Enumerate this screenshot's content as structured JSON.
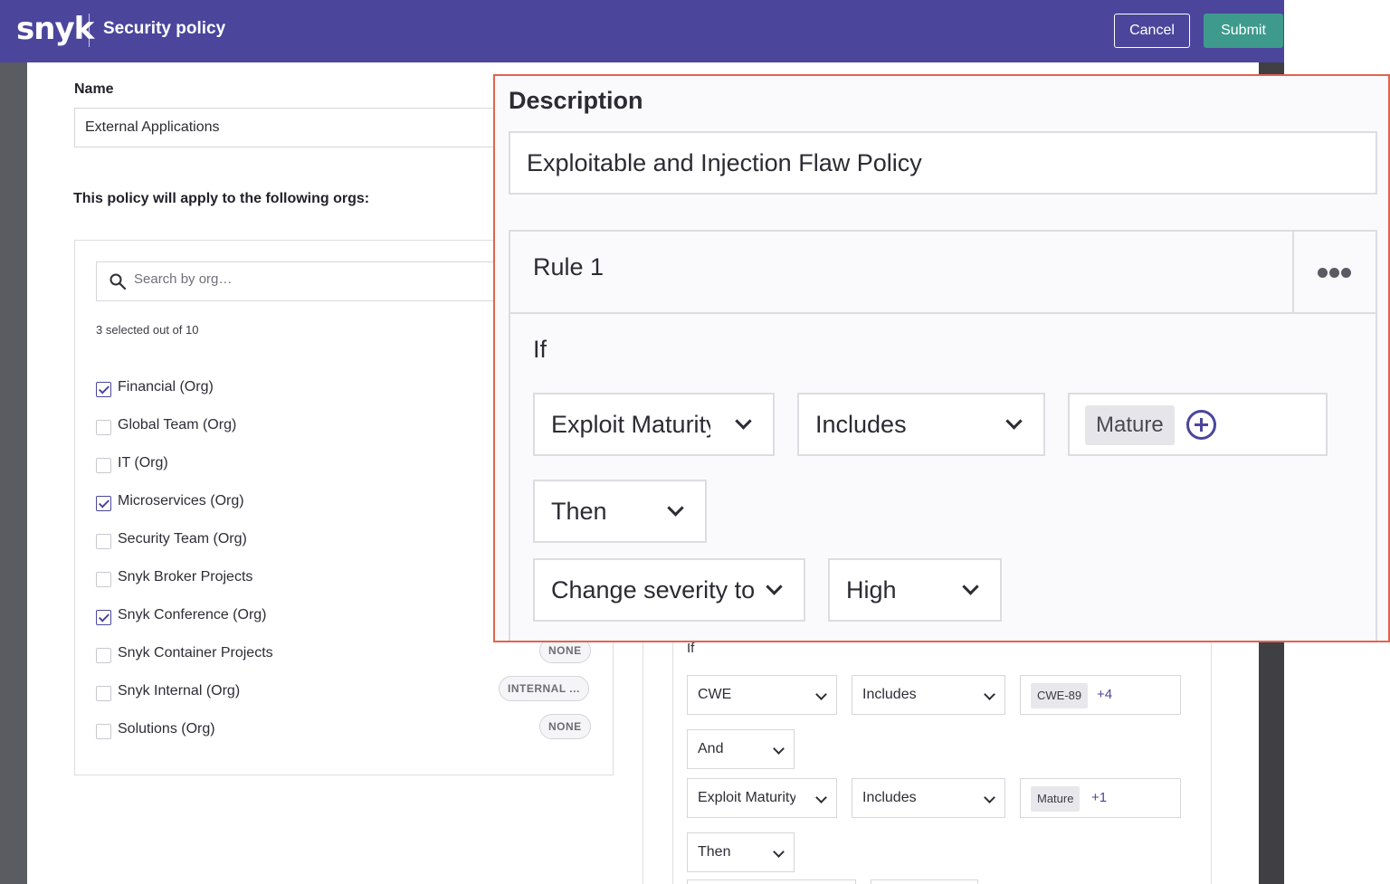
{
  "header": {
    "logo": "snyk",
    "title": "Security policy",
    "cancel_label": "Cancel",
    "submit_label": "Submit"
  },
  "form": {
    "name_label": "Name",
    "name_value": "External Applications",
    "orgs_label": "This policy will apply to the following orgs:",
    "search_placeholder": "Search by org…",
    "selected_count": "3 selected out of 10"
  },
  "orgs": [
    {
      "label": "Financial (Org)",
      "checked": true,
      "badge": ""
    },
    {
      "label": "Global Team (Org)",
      "checked": false,
      "badge": ""
    },
    {
      "label": "IT (Org)",
      "checked": false,
      "badge": ""
    },
    {
      "label": "Microservices (Org)",
      "checked": true,
      "badge": ""
    },
    {
      "label": "Security Team (Org)",
      "checked": false,
      "badge": ""
    },
    {
      "label": "Snyk Broker Projects",
      "checked": false,
      "badge": ""
    },
    {
      "label": "Snyk Conference (Org)",
      "checked": true,
      "badge": ""
    },
    {
      "label": "Snyk Container Projects",
      "checked": false,
      "badge": "NONE"
    },
    {
      "label": "Snyk Internal (Org)",
      "checked": false,
      "badge": "INTERNAL ..."
    },
    {
      "label": "Solutions (Org)",
      "checked": false,
      "badge": "NONE"
    }
  ],
  "rule_card": {
    "if_label": "If",
    "cond1": {
      "field": "CWE",
      "operator": "Includes",
      "tag": "CWE-89",
      "more": "+4"
    },
    "joiner": "And",
    "cond2": {
      "field": "Exploit Maturity",
      "operator": "Includes",
      "tag": "Mature",
      "more": "+1"
    },
    "then_label": "Then"
  },
  "zoom": {
    "description_label": "Description",
    "description_value": "Exploitable and Injection Flaw Policy",
    "rule_title": "Rule 1",
    "if_label": "If",
    "condition_field": "Exploit Maturity",
    "condition_operator": "Includes",
    "condition_tag": "Mature",
    "then_label": "Then",
    "action": "Change severity to",
    "action_value": "High"
  },
  "icons": {
    "search": "search-icon",
    "more": "more-options-icon",
    "add": "add-circle-icon",
    "chevron": "chevron-down-icon"
  },
  "colors": {
    "header_bg": "#4b469c",
    "submit_bg": "#3e9a8c",
    "callout_border": "#e0644e"
  }
}
